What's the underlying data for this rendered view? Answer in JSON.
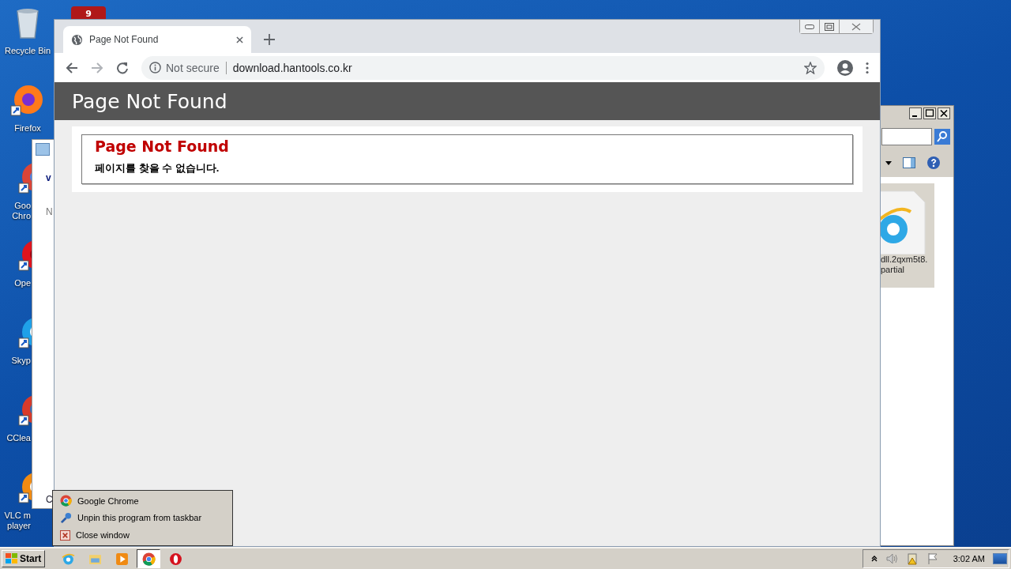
{
  "desktop": {
    "badge": "9",
    "icons": [
      {
        "kind": "recycle",
        "label_lines": [
          "Recycle Bin"
        ],
        "cut": false
      },
      {
        "kind": "firefox",
        "label_lines": [
          "Firefox"
        ],
        "cut": false
      },
      {
        "kind": "chrome",
        "label_lines": [
          "Goo",
          "Chro"
        ],
        "cut": true
      },
      {
        "kind": "opera",
        "label_lines": [
          "Ope"
        ],
        "cut": true
      },
      {
        "kind": "skype",
        "label_lines": [
          "Skyp"
        ],
        "cut": true
      },
      {
        "kind": "ccleaner",
        "label_lines": [
          "CClea"
        ],
        "cut": true
      },
      {
        "kind": "vlc",
        "label_lines": [
          "VLC m",
          "player"
        ],
        "cut": true
      }
    ]
  },
  "background_window_left": {
    "texts": [
      "v",
      "N",
      "C"
    ]
  },
  "background_window_right": {
    "file_lines": [
      "dll.2qxm5t8.",
      "partial"
    ]
  },
  "browser": {
    "tab": {
      "title": "Page Not Found",
      "selected": true
    },
    "address": {
      "security": "Not secure",
      "url": "download.hantools.co.kr"
    },
    "page": {
      "banner": "Page Not Found",
      "heading": "Page Not Found",
      "message": "페이지를 찾을 수 없습니다."
    }
  },
  "context_menu": {
    "items": [
      {
        "kind": "app",
        "label": "Google Chrome"
      },
      {
        "kind": "unpin",
        "label": "Unpin this program from taskbar"
      },
      {
        "kind": "close",
        "label": "Close window"
      }
    ]
  },
  "taskbar": {
    "start": "Start",
    "pinned": [
      {
        "kind": "ie",
        "selected": false
      },
      {
        "kind": "folder",
        "selected": false
      },
      {
        "kind": "media",
        "selected": false
      },
      {
        "kind": "chrome",
        "selected": true
      },
      {
        "kind": "opera",
        "selected": false
      }
    ],
    "clock": "3:02 AM"
  }
}
